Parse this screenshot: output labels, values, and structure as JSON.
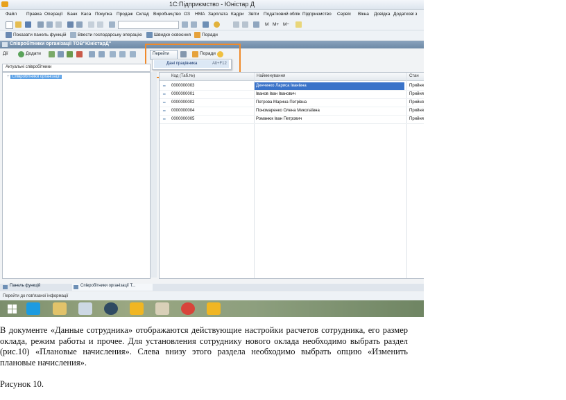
{
  "app": {
    "title": "1С:Підприємство - Юністар Д"
  },
  "menu": [
    "Файл",
    "Правка",
    "Операції",
    "Банк",
    "Каса",
    "Покупка",
    "Продаж",
    "Склад",
    "Виробництво",
    "ОЗ",
    "НМА",
    "Зарплата",
    "Кадри",
    "Звіти",
    "Податковий облік",
    "Підприємство",
    "Сервіс",
    "Вікна",
    "Довідка",
    "Додаткові з"
  ],
  "toolbar": {
    "calc_m": "M",
    "calc_mplus": "M+",
    "calc_mminus": "M−"
  },
  "toolbar2": {
    "show_panel": "Показати панель функцій",
    "enter_operation": "Ввести господарську операцію",
    "quick_start": "Швидке освоєння",
    "tips": "Поради"
  },
  "window": {
    "title": "Співробітники організації  ТОВ\"ЮністарД\""
  },
  "form_toolbar": {
    "actions": "Дії",
    "add": "Додати",
    "goto": "Перейти",
    "tips": "Поради"
  },
  "dropdown": {
    "item_label": "Дані працівника",
    "item_shortcut": "Alt+F12"
  },
  "filter": {
    "value": "Актуальні співробітники"
  },
  "tree": {
    "root": "Співробітники організації"
  },
  "grid": {
    "columns": [
      "Код (Таб.№)",
      "Найменування",
      "Стан"
    ],
    "rows": [
      {
        "code": "0000000003",
        "name": "Денченко Лариса Іванівна",
        "state": "Прийнят",
        "selected": true
      },
      {
        "code": "0000000001",
        "name": "Іванов Іван Іванович",
        "state": "Прийнят",
        "selected": false
      },
      {
        "code": "0000000002",
        "name": "Петрова  Марина  Петрівна",
        "state": "Прийнят",
        "selected": false
      },
      {
        "code": "0000000004",
        "name": "Пономаренко  Олена Миколаївна",
        "state": "Прийнят",
        "selected": false
      },
      {
        "code": "0000000005",
        "name": "Романюк Іван Петрович",
        "state": "Прийнят",
        "selected": false
      }
    ]
  },
  "tabs": [
    "Панель функцій",
    "Співробітники організації Т..."
  ],
  "status": "Перейти до пов'язаної інформації",
  "colors": {
    "highlight_border": "#f08a2a",
    "selection": "#3a73c9",
    "window_title": "#7a94b0"
  },
  "document": {
    "paragraph": "В документе «Данные сотрудника» отображаются действующие настройки расчетов сотрудника, его размер оклада, режим работы и прочее. Для установления сотруднику нового оклада необходимо выбрать раздел (рис.10) «Плановые начисления». Слева внизу этого раздела необходимо выбрать опцию «Изменить плановые начисления».",
    "figure_label": "Рисунок 10."
  }
}
